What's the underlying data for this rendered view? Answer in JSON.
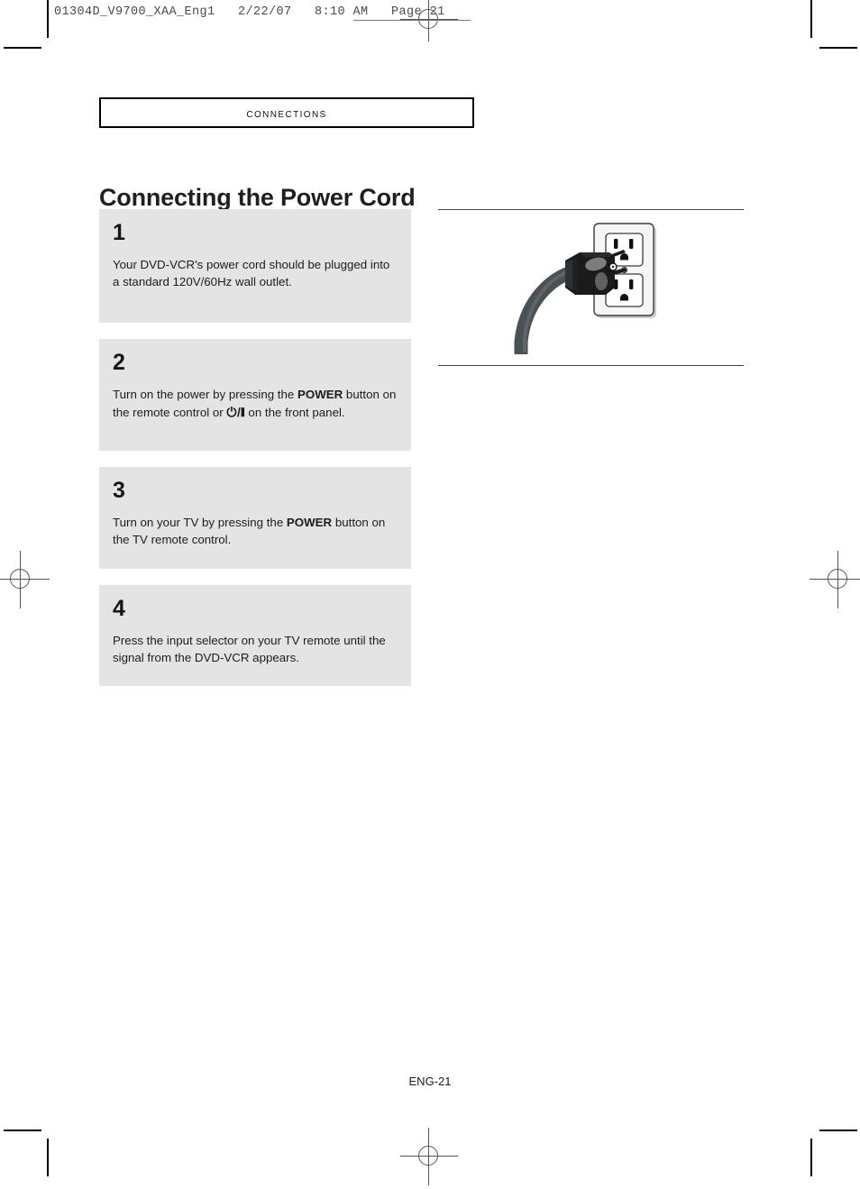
{
  "print_marks": {
    "file_strip": "01304D_V9700_XAA_Eng1   2/22/07   8:10 AM   Page 21"
  },
  "chapter": {
    "label": "CONNECTIONS"
  },
  "title": "Connecting the Power Cord",
  "steps": [
    {
      "number": "1",
      "text_parts": [
        {
          "type": "plain",
          "text": "Your DVD-VCR's power cord should be plugged into a standard 120V/60Hz wall outlet."
        }
      ]
    },
    {
      "number": "2",
      "text_parts": [
        {
          "type": "plain",
          "text": "Turn on the power by pressing the "
        },
        {
          "type": "bold",
          "text": "POWER"
        },
        {
          "type": "plain",
          "text": " button on the remote control or "
        },
        {
          "type": "symbol",
          "text": "⏻/❙"
        },
        {
          "type": "plain",
          "text": " on the front panel."
        }
      ]
    },
    {
      "number": "3",
      "text_parts": [
        {
          "type": "plain",
          "text": "Turn on your TV by pressing the "
        },
        {
          "type": "bold",
          "text": "POWER"
        },
        {
          "type": "plain",
          "text": " button on the TV remote control."
        }
      ]
    },
    {
      "number": "4",
      "text_parts": [
        {
          "type": "plain",
          "text": "Press the input selector on your TV remote until the signal from the DVD-VCR appears."
        }
      ]
    }
  ],
  "figure": {
    "name": "power-cord-plugged-into-wall-outlet",
    "colors": {
      "plug_body": "#1b1b1b",
      "plug_highlight": "#8b8e90",
      "cord": "#4a5155",
      "outlet_plate": "#f4f4f4",
      "outlet_shadow": "#c9cdd0",
      "slot": "#111111"
    }
  },
  "footer": {
    "page_label": "ENG-21"
  }
}
